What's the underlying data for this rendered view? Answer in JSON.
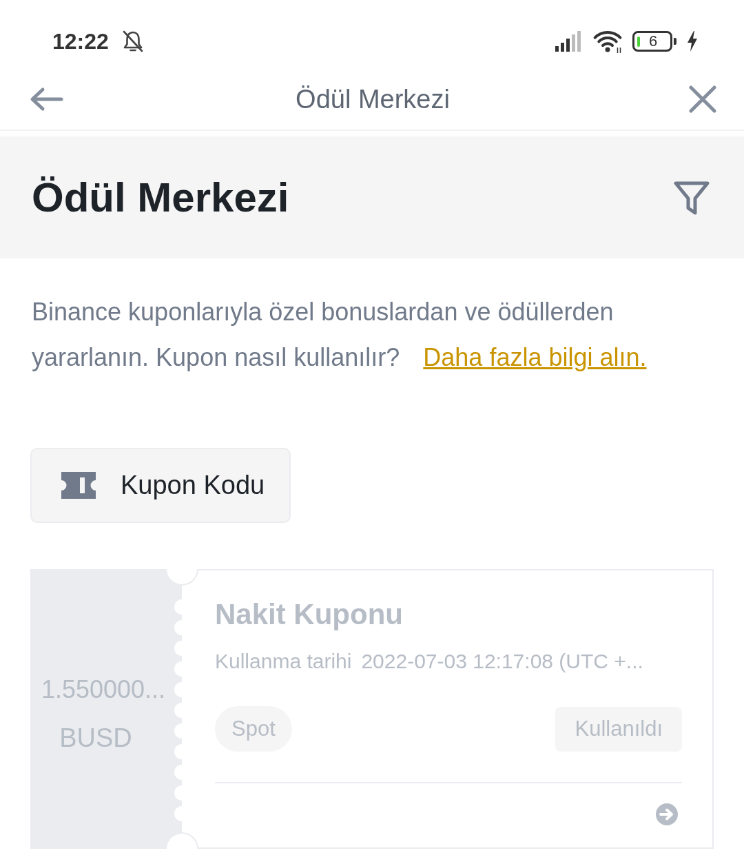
{
  "status_bar": {
    "time": "12:22",
    "battery_text": "6"
  },
  "nav_bar": {
    "title": "Ödül Merkezi"
  },
  "header": {
    "title": "Ödül Merkezi"
  },
  "intro": {
    "text": "Binance kuponlarıyla özel bonuslardan ve ödüllerden yararlanın. Kupon nasıl kullanılır?",
    "link": "Daha fazla bilgi alın."
  },
  "coupon_code_button": {
    "label": "Kupon Kodu"
  },
  "coupons": [
    {
      "amount": "1.550000...",
      "currency": "BUSD",
      "title": "Nakit Kuponu",
      "expiry_label": "Kullanma tarihi",
      "expiry": "2022-07-03 12:17:08 (UTC +...",
      "tag": "Spot",
      "status": "Kullanıldı",
      "used": true
    }
  ]
}
